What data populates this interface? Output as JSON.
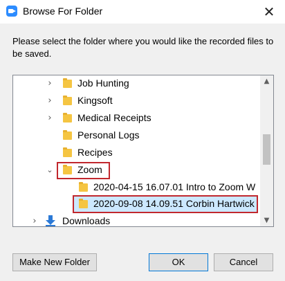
{
  "window": {
    "title": "Browse For Folder",
    "close_symbol": "✕"
  },
  "instruction": "Please select the folder where you would like the recorded files to be saved.",
  "tree": {
    "items": [
      {
        "label": "Job Hunting",
        "expandable": true
      },
      {
        "label": "Kingsoft",
        "expandable": true
      },
      {
        "label": "Medical Receipts",
        "expandable": true
      },
      {
        "label": "Personal Logs",
        "expandable": false
      },
      {
        "label": "Recipes",
        "expandable": false
      },
      {
        "label": "Zoom",
        "expanded": true,
        "highlighted": true
      },
      {
        "label": "2020-04-15 16.07.01 Intro to Zoom W",
        "expandable": false
      },
      {
        "label": "2020-09-08 14.09.51 Corbin Hartwick",
        "expandable": false,
        "selected": true,
        "highlighted": true
      },
      {
        "label": "Downloads",
        "expandable": true,
        "icon": "download-arrow-icon"
      }
    ]
  },
  "buttons": {
    "make_new_folder": "Make New Folder",
    "ok": "OK",
    "cancel": "Cancel"
  },
  "colors": {
    "highlight_box": "#c1272d",
    "selection": "#cce8ff",
    "folder": "#f5c542",
    "download_icon": "#2b79d6",
    "app_icon": "#2d8cff"
  }
}
